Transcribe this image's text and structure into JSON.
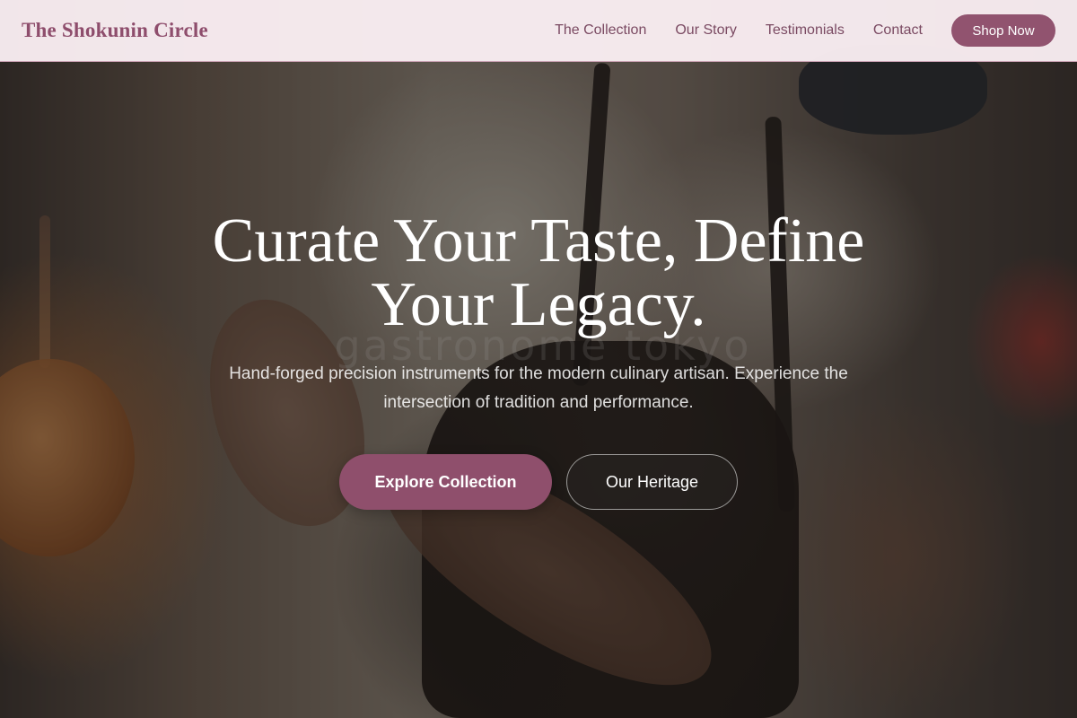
{
  "header": {
    "brand": "The Shokunin Circle",
    "nav": [
      {
        "label": "The Collection"
      },
      {
        "label": "Our Story"
      },
      {
        "label": "Testimonials"
      },
      {
        "label": "Contact"
      }
    ],
    "cta_label": "Shop Now"
  },
  "hero": {
    "title_line1": "Curate Your Taste, Define",
    "title_line2": "Your Legacy.",
    "subtitle_line1": "Hand-forged precision instruments for the modern culinary artisan. Experience the",
    "subtitle_line2": "intersection of tradition and performance.",
    "primary_button": "Explore Collection",
    "secondary_button": "Our Heritage",
    "background_watermark": "gastronome tokyo"
  },
  "colors": {
    "accent": "#8f4f6c",
    "header_bg": "#faeef2",
    "brand_text": "#8e4d6c",
    "nav_text": "#7a4a62"
  }
}
